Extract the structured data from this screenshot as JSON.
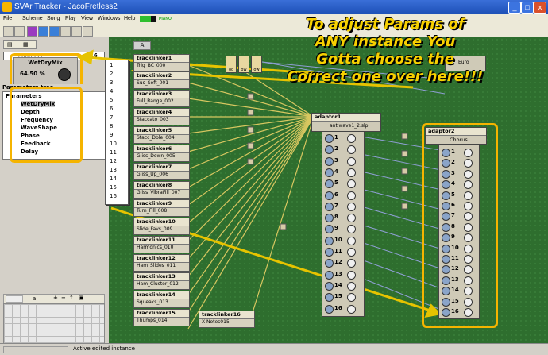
{
  "window": {
    "title": "SVAr Tracker - JacoFretless2",
    "minimize": "_",
    "maximize": "□",
    "close": "x"
  },
  "menu": [
    "File",
    "Scheme",
    "Song",
    "Play",
    "View",
    "Windows",
    "Help"
  ],
  "toolbar": {
    "meter_label": "PIANO"
  },
  "left_panel": {
    "instance_field": "adaptor2",
    "instance_num": "16",
    "plugin": {
      "name": "WetDryMix",
      "value": "64.50 %"
    },
    "tree_title": "Parameters tree",
    "tree_root": "Parameters",
    "params": [
      "WetDryMix",
      "Depth",
      "Frequency",
      "WaveShape",
      "Phase",
      "Feedback",
      "Delay"
    ],
    "selected_param": "WetDryMix",
    "bottom_combo": "a"
  },
  "dropdown": {
    "items": [
      "1",
      "2",
      "3",
      "4",
      "5",
      "6",
      "7",
      "8",
      "9",
      "10",
      "11",
      "12",
      "13",
      "14",
      "15",
      "16"
    ]
  },
  "canvas": {
    "tab_label": "A",
    "tracklinkers": [
      {
        "title": "tracklinker1",
        "name": "Trig_BC_000"
      },
      {
        "title": "tracklinker2",
        "name": "Sus_Soft_001"
      },
      {
        "title": "tracklinker3",
        "name": "Full_Range_002"
      },
      {
        "title": "tracklinker4",
        "name": "Staccato_003"
      },
      {
        "title": "tracklinker5",
        "name": "Stacc_Dble_004"
      },
      {
        "title": "tracklinker6",
        "name": "Gliss_Down_005"
      },
      {
        "title": "tracklinker7",
        "name": "Gliss_Up_006"
      },
      {
        "title": "tracklinker8",
        "name": "Gliss_VibraFill_007"
      },
      {
        "title": "tracklinker9",
        "name": "Turn_Fill_008"
      },
      {
        "title": "tracklinker10",
        "name": "Slide_Favs_009"
      },
      {
        "title": "tracklinker11",
        "name": "Harmonics_010"
      },
      {
        "title": "tracklinker12",
        "name": "Ham_Slides_011"
      },
      {
        "title": "tracklinker13",
        "name": "Ham_Cluster_012"
      },
      {
        "title": "tracklinker14",
        "name": "Squeaks_013"
      },
      {
        "title": "tracklinker15",
        "name": "Thumps_014"
      }
    ],
    "tracklinker16": {
      "title": "tracklinker16",
      "name": "X-Notes015"
    },
    "small_buttons": [
      "oo",
      "ow"
    ],
    "adaptor1": {
      "title": "adaptor1",
      "file": "antiwave1_2.slp"
    },
    "adaptor2": {
      "title": "adaptor2",
      "effect": "Chorus"
    },
    "top_right_tab": "Euro",
    "rows": [
      "1",
      "2",
      "3",
      "4",
      "5",
      "6",
      "7",
      "8",
      "9",
      "10",
      "11",
      "12",
      "13",
      "14",
      "15",
      "16"
    ]
  },
  "annotation": {
    "line1": "To adjust Params of",
    "line2": "ANY instance You",
    "line3": "Gotta choose the",
    "line4": "Correct one over here!!!"
  },
  "status": {
    "text": "Active edited instance"
  },
  "colors": {
    "highlight": "#f5b400",
    "canvas": "#2e6e2e",
    "arrow": "#e6c300",
    "link": "#d8c760"
  }
}
